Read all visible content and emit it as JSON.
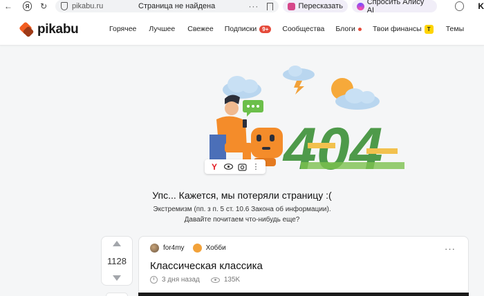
{
  "browser": {
    "domain": "pikabu.ru",
    "tab_title": "Страница не найдена",
    "retell_label": "Пересказать",
    "alice_label": "Спросить Алису AI",
    "yandex_glyph": "Я"
  },
  "site": {
    "logo_text": "pikabu",
    "brand_color": "#f25e21",
    "nav": {
      "hot": "Горячее",
      "best": "Лучшее",
      "fresh": "Свежее",
      "subs": "Подписки",
      "subs_badge": "9+",
      "communities": "Сообщества",
      "blogs": "Блоги",
      "finance": "Твои финансы",
      "finance_badge": "Т",
      "topics": "Темы"
    }
  },
  "error_page": {
    "code": "404",
    "title": "Упс... Кажется, мы потеряли страницу :(",
    "line1": "Экстремизм (пп. з п. 5 ст. 10.6 Закона об информации).",
    "line2": "Давайте почитаем что-нибудь еще?"
  },
  "image_toolbar": {
    "yandex_glyph": "Y",
    "icons": [
      "yandex-icon",
      "eye-icon",
      "image-search-icon",
      "more-vertical-icon"
    ]
  },
  "post": {
    "rating": "1128",
    "author": "for4my",
    "community": "Хобби",
    "title": "Классическая классика",
    "time": "3 дня назад",
    "views": "135K"
  }
}
